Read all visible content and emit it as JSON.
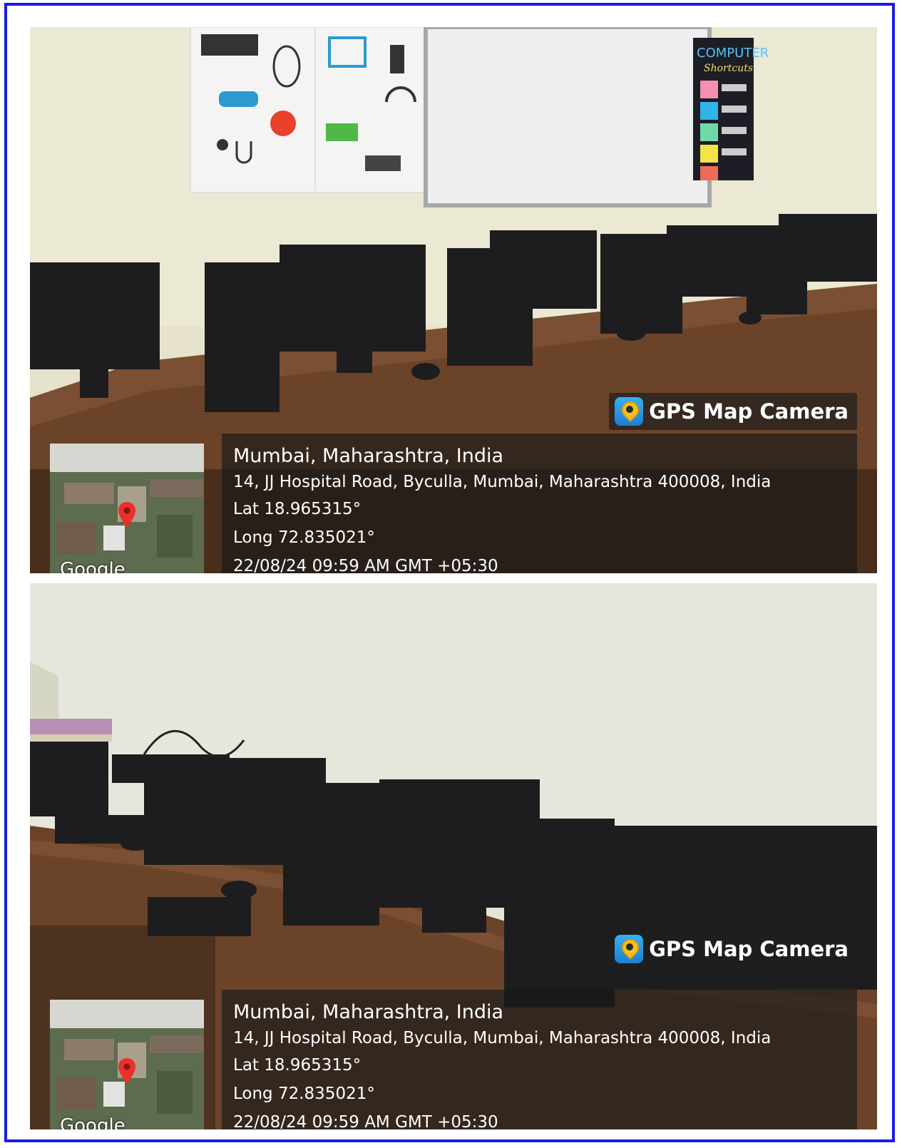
{
  "photos": [
    {
      "gps_badge": {
        "label": "GPS Map Camera",
        "icon": "gps-map-camera-app-icon"
      },
      "location": {
        "title": "Mumbai, Maharashtra, India",
        "address": "14, JJ Hospital Road, Byculla, Mumbai, Maharashtra 400008, India",
        "lat": "Lat 18.965315°",
        "long": "Long 72.835021°",
        "datetime": "22/08/24 09:59 AM GMT +05:30"
      },
      "map": {
        "attribution": "Google",
        "marker_icon": "map-pin-icon"
      },
      "scene_text": {
        "poster_title": "COMPUTER",
        "poster_subtitle": "Shortcuts"
      }
    },
    {
      "gps_badge": {
        "label": "GPS Map Camera",
        "icon": "gps-map-camera-app-icon"
      },
      "location": {
        "title": "Mumbai, Maharashtra, India",
        "address": "14, JJ Hospital Road, Byculla, Mumbai, Maharashtra 400008, India",
        "lat": "Lat 18.965315°",
        "long": "Long 72.835021°",
        "datetime": "22/08/24 09:59 AM GMT +05:30"
      },
      "map": {
        "attribution": "Google",
        "marker_icon": "map-pin-icon"
      }
    }
  ],
  "colors": {
    "frame_border": "#1a1ae6",
    "wall": "#e8e4cf",
    "desk": "#6b4329",
    "pc": "#1d1d1f",
    "overlay": "rgba(25,25,25,0.66)"
  }
}
